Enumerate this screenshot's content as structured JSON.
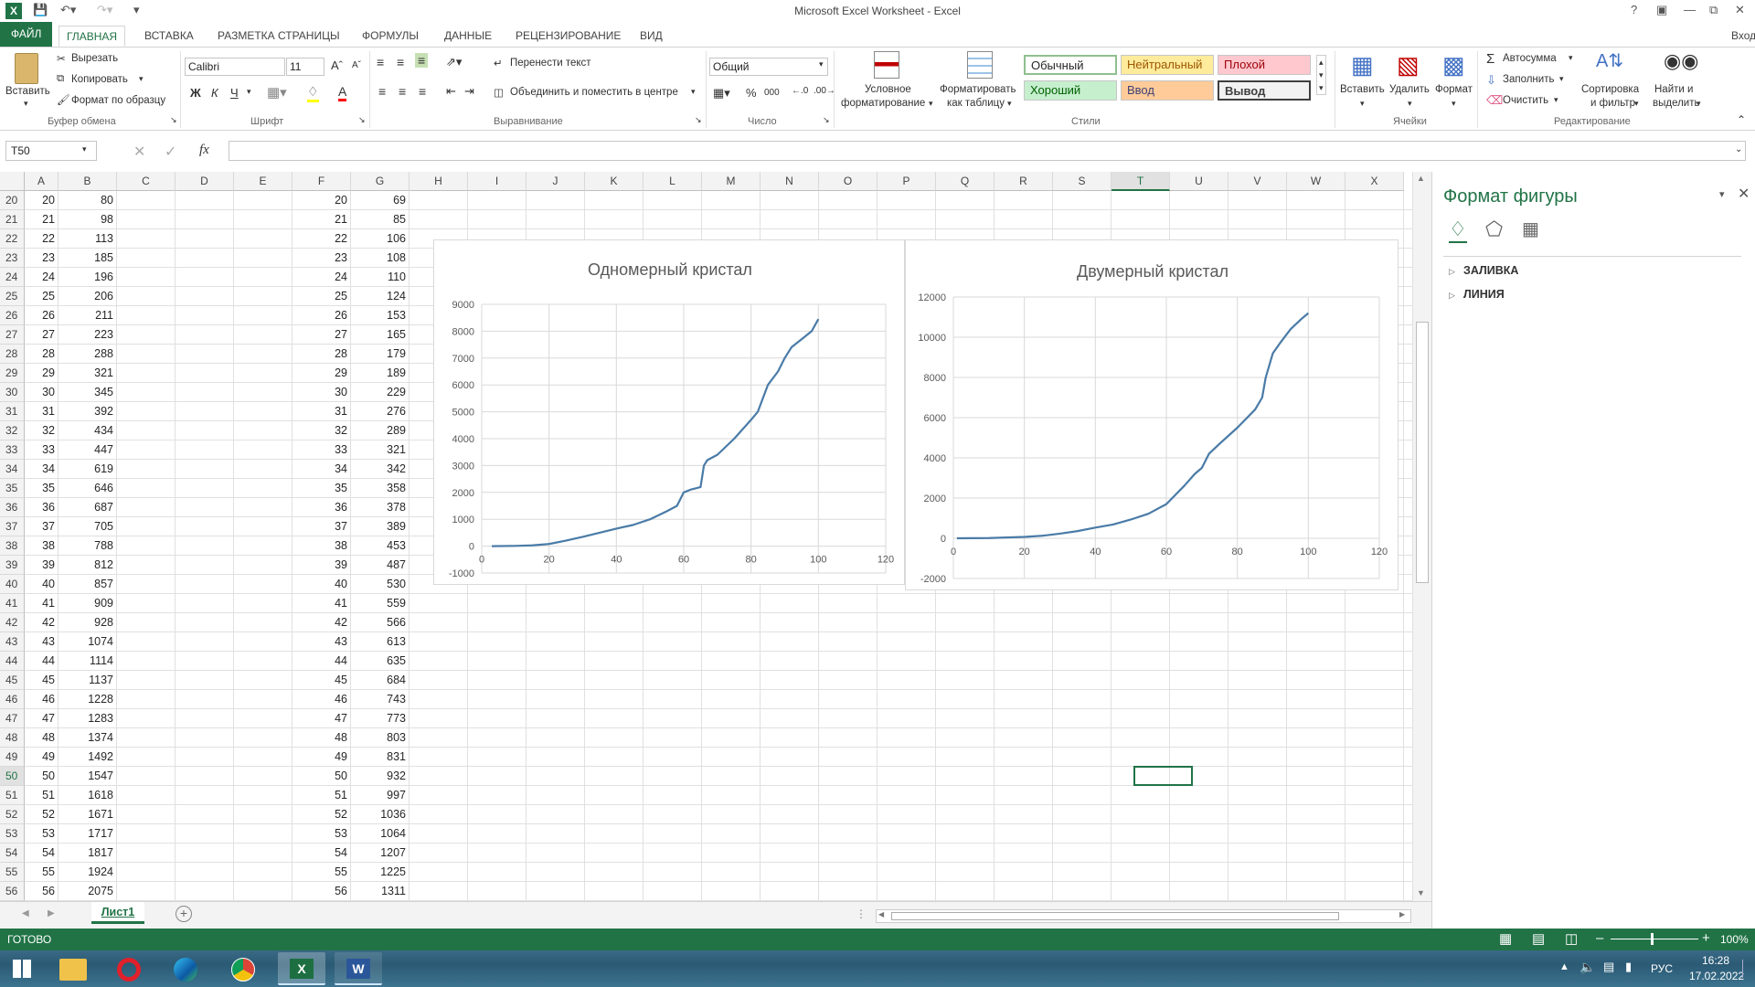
{
  "title": "Microsoft Excel Worksheet - Excel",
  "login_label": "Вход",
  "tabs": [
    "ФАЙЛ",
    "ГЛАВНАЯ",
    "ВСТАВКА",
    "РАЗМЕТКА СТРАНИЦЫ",
    "ФОРМУЛЫ",
    "ДАННЫЕ",
    "РЕЦЕНЗИРОВАНИЕ",
    "ВИД"
  ],
  "ribbon": {
    "clipboard": {
      "paste": "Вставить",
      "cut": "Вырезать",
      "copy": "Копировать",
      "format_painter": "Формат по образцу",
      "group": "Буфер обмена"
    },
    "font": {
      "name": "Calibri",
      "size": "11",
      "group": "Шрифт",
      "bold": "Ж",
      "italic": "К",
      "underline": "Ч"
    },
    "alignment": {
      "wrap": "Перенести текст",
      "merge": "Объединить и поместить в центре",
      "group": "Выравнивание"
    },
    "number": {
      "format": "Общий",
      "group": "Число",
      "percent": "%",
      "thousands": "000"
    },
    "styles": {
      "conditional": "Условное",
      "conditional2": "форматирование",
      "as_table": "Форматировать",
      "as_table2": "как таблицу",
      "group": "Стили",
      "cells": [
        {
          "label": "Обычный",
          "bg": "#ffffff",
          "fg": "#000000"
        },
        {
          "label": "Нейтральный",
          "bg": "#ffeb9c",
          "fg": "#9c5700"
        },
        {
          "label": "Плохой",
          "bg": "#ffc7ce",
          "fg": "#9c0006"
        },
        {
          "label": "Хороший",
          "bg": "#c6efce",
          "fg": "#006100"
        },
        {
          "label": "Ввод",
          "bg": "#ffcc99",
          "fg": "#3f3f76"
        },
        {
          "label": "Вывод",
          "bg": "#f2f2f2",
          "fg": "#3f3f3f"
        }
      ]
    },
    "cells": {
      "insert": "Вставить",
      "delete": "Удалить",
      "format": "Формат",
      "group": "Ячейки"
    },
    "editing": {
      "autosum": "Автосумма",
      "fill": "Заполнить",
      "clear": "Очистить",
      "sort": "Сортировка",
      "sort2": "и фильтр",
      "find": "Найти и",
      "find2": "выделить",
      "group": "Редактирование"
    }
  },
  "namebox": "T50",
  "fx_label": "fx",
  "columns": [
    "A",
    "B",
    "C",
    "D",
    "E",
    "F",
    "G",
    "H",
    "I",
    "J",
    "K",
    "L",
    "M",
    "N",
    "O",
    "P",
    "Q",
    "R",
    "S",
    "T",
    "U",
    "V",
    "W",
    "X"
  ],
  "selected_column": "T",
  "rows": [
    {
      "n": "20",
      "a": "20",
      "b": "80",
      "f": "20",
      "g": "69"
    },
    {
      "n": "21",
      "a": "21",
      "b": "98",
      "f": "21",
      "g": "85"
    },
    {
      "n": "22",
      "a": "22",
      "b": "113",
      "f": "22",
      "g": "106"
    },
    {
      "n": "23",
      "a": "23",
      "b": "185",
      "f": "23",
      "g": "108"
    },
    {
      "n": "24",
      "a": "24",
      "b": "196",
      "f": "24",
      "g": "110"
    },
    {
      "n": "25",
      "a": "25",
      "b": "206",
      "f": "25",
      "g": "124"
    },
    {
      "n": "26",
      "a": "26",
      "b": "211",
      "f": "26",
      "g": "153"
    },
    {
      "n": "27",
      "a": "27",
      "b": "223",
      "f": "27",
      "g": "165"
    },
    {
      "n": "28",
      "a": "28",
      "b": "288",
      "f": "28",
      "g": "179"
    },
    {
      "n": "29",
      "a": "29",
      "b": "321",
      "f": "29",
      "g": "189"
    },
    {
      "n": "30",
      "a": "30",
      "b": "345",
      "f": "30",
      "g": "229"
    },
    {
      "n": "31",
      "a": "31",
      "b": "392",
      "f": "31",
      "g": "276"
    },
    {
      "n": "32",
      "a": "32",
      "b": "434",
      "f": "32",
      "g": "289"
    },
    {
      "n": "33",
      "a": "33",
      "b": "447",
      "f": "33",
      "g": "321"
    },
    {
      "n": "34",
      "a": "34",
      "b": "619",
      "f": "34",
      "g": "342"
    },
    {
      "n": "35",
      "a": "35",
      "b": "646",
      "f": "35",
      "g": "358"
    },
    {
      "n": "36",
      "a": "36",
      "b": "687",
      "f": "36",
      "g": "378"
    },
    {
      "n": "37",
      "a": "37",
      "b": "705",
      "f": "37",
      "g": "389"
    },
    {
      "n": "38",
      "a": "38",
      "b": "788",
      "f": "38",
      "g": "453"
    },
    {
      "n": "39",
      "a": "39",
      "b": "812",
      "f": "39",
      "g": "487"
    },
    {
      "n": "40",
      "a": "40",
      "b": "857",
      "f": "40",
      "g": "530"
    },
    {
      "n": "41",
      "a": "41",
      "b": "909",
      "f": "41",
      "g": "559"
    },
    {
      "n": "42",
      "a": "42",
      "b": "928",
      "f": "42",
      "g": "566"
    },
    {
      "n": "43",
      "a": "43",
      "b": "1074",
      "f": "43",
      "g": "613"
    },
    {
      "n": "44",
      "a": "44",
      "b": "1114",
      "f": "44",
      "g": "635"
    },
    {
      "n": "45",
      "a": "45",
      "b": "1137",
      "f": "45",
      "g": "684"
    },
    {
      "n": "46",
      "a": "46",
      "b": "1228",
      "f": "46",
      "g": "743"
    },
    {
      "n": "47",
      "a": "47",
      "b": "1283",
      "f": "47",
      "g": "773"
    },
    {
      "n": "48",
      "a": "48",
      "b": "1374",
      "f": "48",
      "g": "803"
    },
    {
      "n": "49",
      "a": "49",
      "b": "1492",
      "f": "49",
      "g": "831"
    },
    {
      "n": "50",
      "a": "50",
      "b": "1547",
      "f": "50",
      "g": "932"
    },
    {
      "n": "51",
      "a": "51",
      "b": "1618",
      "f": "51",
      "g": "997"
    },
    {
      "n": "52",
      "a": "52",
      "b": "1671",
      "f": "52",
      "g": "1036"
    },
    {
      "n": "53",
      "a": "53",
      "b": "1717",
      "f": "53",
      "g": "1064"
    },
    {
      "n": "54",
      "a": "54",
      "b": "1817",
      "f": "54",
      "g": "1207"
    },
    {
      "n": "55",
      "a": "55",
      "b": "1924",
      "f": "55",
      "g": "1225"
    },
    {
      "n": "56",
      "a": "56",
      "b": "2075",
      "f": "56",
      "g": "1311"
    }
  ],
  "selected_row": "50",
  "chart_data": [
    {
      "type": "line",
      "title": "Одномерный кристал",
      "xlabel": "",
      "ylabel": "",
      "xlim": [
        0,
        120
      ],
      "ylim": [
        -1000,
        9000
      ],
      "xticks": [
        "0",
        "20",
        "40",
        "60",
        "80",
        "100",
        "120"
      ],
      "yticks": [
        "-1000",
        "0",
        "1000",
        "2000",
        "3000",
        "4000",
        "5000",
        "6000",
        "7000",
        "8000",
        "9000"
      ],
      "series": [
        {
          "color": "#4a7ba7",
          "x": [
            3,
            10,
            15,
            20,
            25,
            30,
            35,
            40,
            45,
            50,
            55,
            58,
            60,
            62,
            65,
            66,
            67,
            70,
            75,
            80,
            82,
            85,
            88,
            90,
            92,
            95,
            98,
            100
          ],
          "y": [
            0,
            10,
            30,
            80,
            206,
            345,
            500,
            650,
            790,
            1000,
            1300,
            1500,
            2000,
            2100,
            2200,
            3000,
            3200,
            3400,
            4000,
            4700,
            5000,
            6000,
            6500,
            7000,
            7400,
            7700,
            8000,
            8450
          ]
        }
      ]
    },
    {
      "type": "line",
      "title": "Двумерный кристал",
      "xlabel": "",
      "ylabel": "",
      "xlim": [
        0,
        120
      ],
      "ylim": [
        -2000,
        12000
      ],
      "xticks": [
        "0",
        "20",
        "40",
        "60",
        "80",
        "100",
        "120"
      ],
      "yticks": [
        "-2000",
        "0",
        "2000",
        "4000",
        "6000",
        "8000",
        "10000",
        "12000"
      ],
      "series": [
        {
          "color": "#4a7ba7",
          "x": [
            1,
            10,
            20,
            25,
            30,
            35,
            40,
            45,
            50,
            55,
            60,
            65,
            68,
            70,
            72,
            75,
            80,
            85,
            87,
            88,
            90,
            92,
            95,
            98,
            100
          ],
          "y": [
            0,
            10,
            69,
            124,
            229,
            358,
            530,
            684,
            932,
            1225,
            1700,
            2600,
            3200,
            3500,
            4200,
            4700,
            5500,
            6400,
            7000,
            8000,
            9200,
            9700,
            10400,
            10900,
            11200
          ]
        }
      ]
    }
  ],
  "panel": {
    "title": "Формат фигуры",
    "fill": "ЗАЛИВКА",
    "line": "ЛИНИЯ"
  },
  "sheet_tab": "Лист1",
  "status": {
    "ready": "ГОТОВО",
    "zoom": "100%"
  },
  "taskbar": {
    "lang": "РУС",
    "time": "16:28",
    "date": "17.02.2022"
  }
}
